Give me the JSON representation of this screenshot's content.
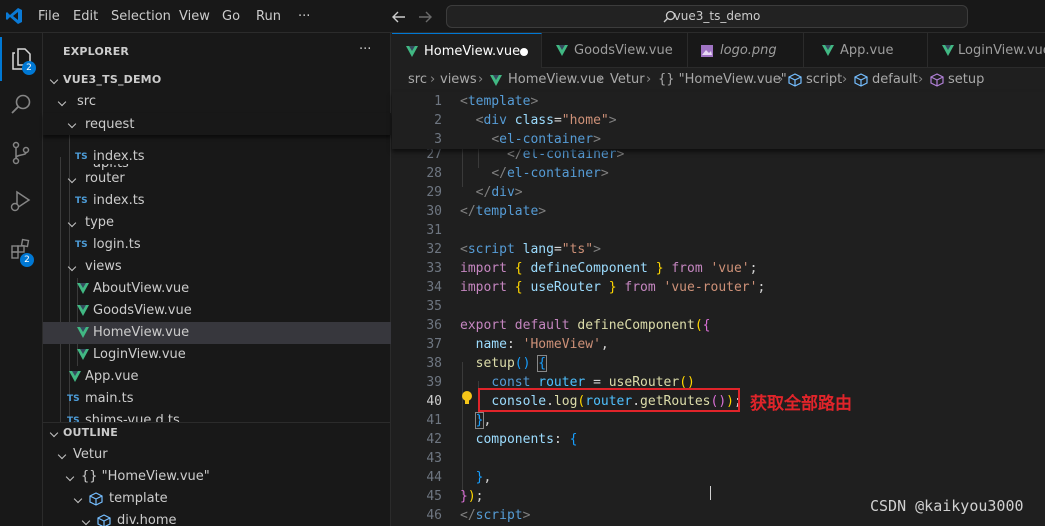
{
  "menu": {
    "file": "File",
    "edit": "Edit",
    "selection": "Selection",
    "view": "View",
    "go": "Go",
    "run": "Run",
    "more": "···"
  },
  "search": {
    "text": "vue3_ts_demo"
  },
  "activity": {
    "explorer_badge": "2",
    "extensions_badge": "2"
  },
  "explorer": {
    "title": "EXPLORER",
    "more": "···",
    "project": "VUE3_TS_DEMO",
    "tree": [
      {
        "label": "src"
      },
      {
        "label": "request"
      },
      {
        "label": "api.ts",
        "ts": "TS"
      },
      {
        "label": "index.ts",
        "ts": "TS"
      },
      {
        "label": "router"
      },
      {
        "label": "index.ts",
        "ts": "TS"
      },
      {
        "label": "type"
      },
      {
        "label": "login.ts",
        "ts": "TS"
      },
      {
        "label": "views"
      },
      {
        "label": "AboutView.vue"
      },
      {
        "label": "GoodsView.vue"
      },
      {
        "label": "HomeView.vue"
      },
      {
        "label": "LoginView.vue"
      },
      {
        "label": "App.vue"
      },
      {
        "label": "main.ts",
        "ts": "TS"
      },
      {
        "label": "shims-vue.d.ts",
        "ts": "TS"
      }
    ]
  },
  "outline": {
    "title": "OUTLINE",
    "items": [
      {
        "label": "Vetur"
      },
      {
        "label": "{} \"HomeView.vue\""
      },
      {
        "label": "template"
      },
      {
        "label": "div.home"
      }
    ]
  },
  "tabs": [
    {
      "label": "HomeView.vue"
    },
    {
      "label": "GoodsView.vue"
    },
    {
      "label": "logo.png"
    },
    {
      "label": "App.vue"
    },
    {
      "label": "LoginView.vue"
    }
  ],
  "breadcrumb": {
    "src": "src",
    "views": "views",
    "file": "HomeView.vue",
    "vetur": "Vetur",
    "obj": "{} \"HomeView.vue\"",
    "script": "script",
    "default": "default",
    "setup": "setup"
  },
  "code": {
    "lines": [
      "1",
      "2",
      "3",
      "27",
      "28",
      "29",
      "30",
      "31",
      "32",
      "33",
      "34",
      "35",
      "36",
      "37",
      "38",
      "39",
      "40",
      "41",
      "42",
      "43",
      "44",
      "45",
      "46"
    ],
    "current_line": "40"
  },
  "annotation": "获取全部路由",
  "watermark": "CSDN @kaikyou3000",
  "colors": {
    "accent": "#0078d4",
    "annotation": "#e0242a",
    "vue_green": "#41b883"
  }
}
